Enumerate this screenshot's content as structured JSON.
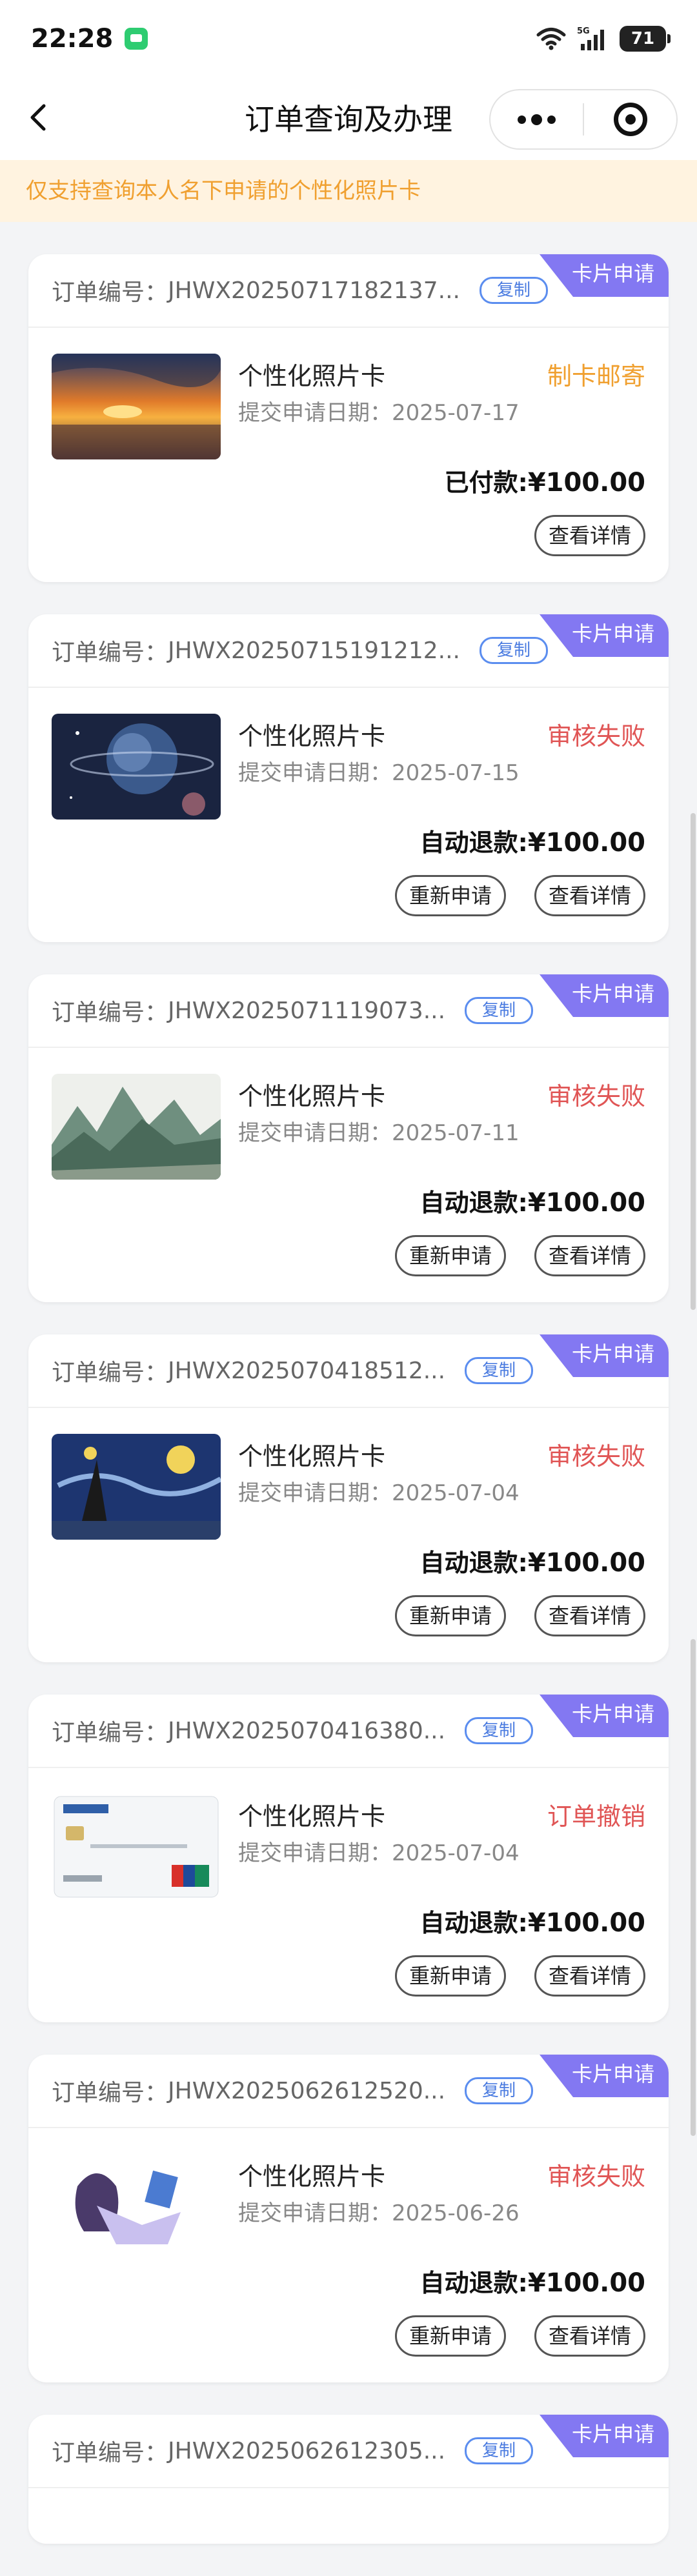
{
  "status_bar": {
    "time": "22:28",
    "battery": "71",
    "network": "5G"
  },
  "nav": {
    "title": "订单查询及办理"
  },
  "notice": "仅支持查询本人名下申请的个性化照片卡",
  "order_label": "订单编号：",
  "copy_label": "复制",
  "tag_label": "卡片申请",
  "product_name": "个性化照片卡",
  "date_prefix": "提交申请日期：",
  "view_detail_label": "查看详情",
  "reapply_label": "重新申请",
  "orders": [
    {
      "order_no": "JHWX20250717182137...",
      "date": "2025-07-17",
      "status": "制卡邮寄",
      "status_color": "orange",
      "amount_label": "已付款:",
      "amount": "¥100.00",
      "thumb": "sunset-image",
      "has_reapply": false
    },
    {
      "order_no": "JHWX20250715191212...",
      "date": "2025-07-15",
      "status": "审核失败",
      "status_color": "red",
      "amount_label": "自动退款:",
      "amount": "¥100.00",
      "thumb": "planet-image",
      "has_reapply": true
    },
    {
      "order_no": "JHWX2025071119073...",
      "date": "2025-07-11",
      "status": "审核失败",
      "status_color": "red",
      "amount_label": "自动退款:",
      "amount": "¥100.00",
      "thumb": "landscape-painting-image",
      "has_reapply": true
    },
    {
      "order_no": "JHWX2025070418512...",
      "date": "2025-07-04",
      "status": "审核失败",
      "status_color": "red",
      "amount_label": "自动退款:",
      "amount": "¥100.00",
      "thumb": "starry-night-image",
      "has_reapply": true
    },
    {
      "order_no": "JHWX2025070416380...",
      "date": "2025-07-04",
      "status": "订单撤销",
      "status_color": "red",
      "amount_label": "自动退款:",
      "amount": "¥100.00",
      "thumb": "bank-card-image",
      "has_reapply": true
    },
    {
      "order_no": "JHWX2025062612520...",
      "date": "2025-06-26",
      "status": "审核失败",
      "status_color": "red",
      "amount_label": "自动退款:",
      "amount": "¥100.00",
      "thumb": "anime-girl-image",
      "has_reapply": true
    },
    {
      "order_no": "JHWX2025062612305...",
      "date": "",
      "status": "",
      "status_color": "red",
      "amount_label": "",
      "amount": "",
      "thumb": "",
      "has_reapply": false
    }
  ],
  "colors": {
    "accent_purple": "#8378f2",
    "status_orange": "#f0a030",
    "status_red": "#e05555",
    "copy_blue": "#4a7be0",
    "notice_bg": "#fff3e0"
  }
}
